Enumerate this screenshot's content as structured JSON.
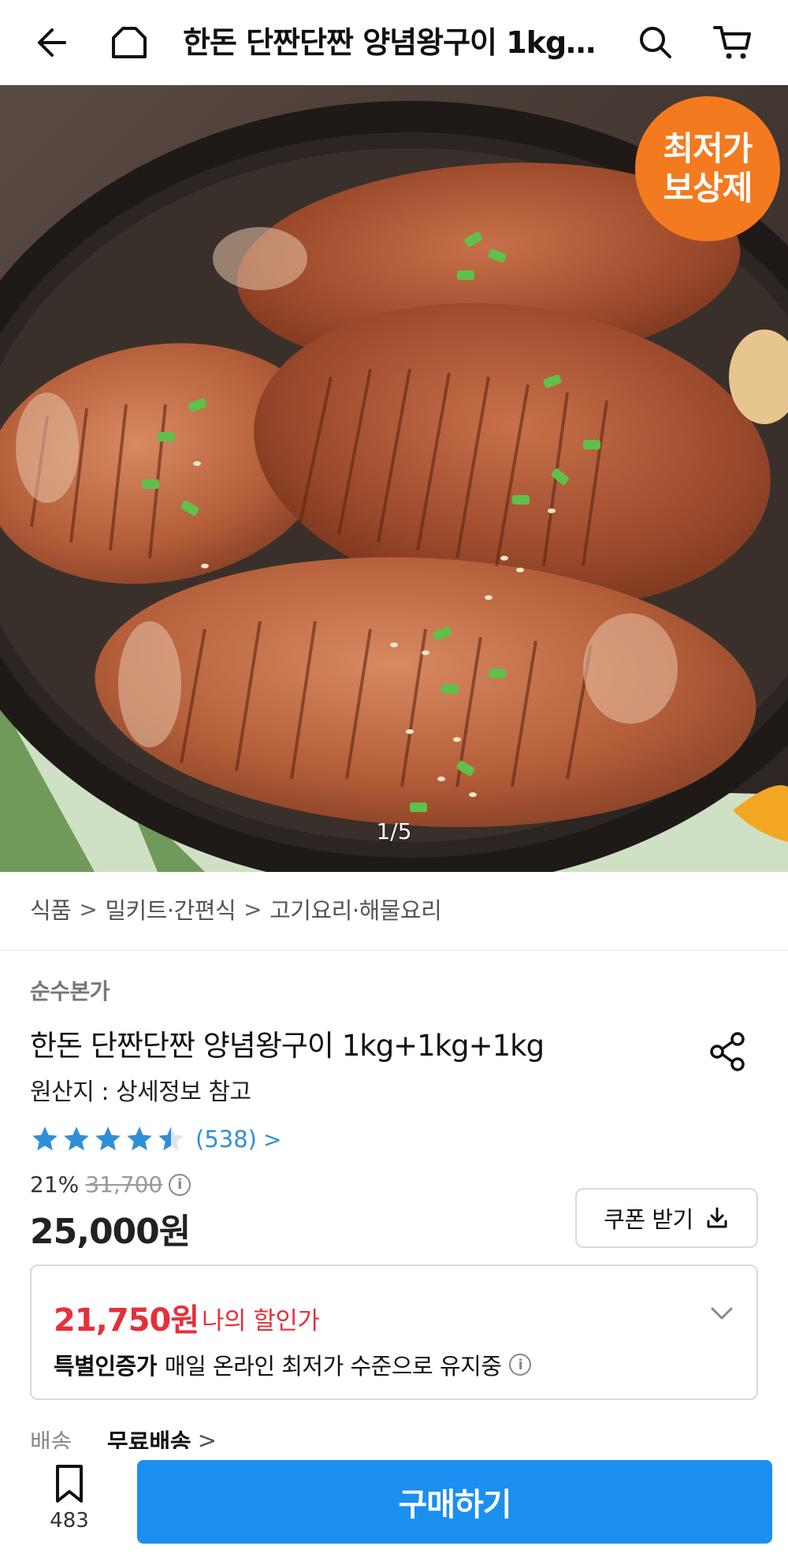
{
  "topbar": {
    "title": "한돈 단짠단짠 양념왕구이 1kg+1kg+1kg",
    "back_icon": "back-arrow-icon",
    "home_icon": "home-icon",
    "search_icon": "search-icon",
    "cart_icon": "cart-icon"
  },
  "hero": {
    "badge_line1": "최저가",
    "badge_line2": "보상제",
    "counter": "1/5"
  },
  "breadcrumb": {
    "items": [
      "식품",
      "밀키트·간편식",
      "고기요리·해물요리"
    ],
    "separator": ">"
  },
  "product": {
    "brand": "순수본가",
    "title": "한돈 단짠단짠 양념왕구이 1kg+1kg+1kg",
    "origin": "원산지 : 상세정보 참고",
    "rating": 4.5,
    "review_count": "(538)",
    "review_chevron": ">",
    "discount_rate": "21%",
    "original_price": "31,700",
    "price": "25,000원",
    "coupon_label": "쿠폰 받기"
  },
  "my_price": {
    "price": "21,750원",
    "label": "나의 할인가",
    "cert_bold": "특별인증가",
    "cert_text": "매일 온라인 최저가 수준으로 유지중"
  },
  "shipping": {
    "label": "배송",
    "value": "무료배송",
    "chevron": ">"
  },
  "bottom": {
    "bookmark_count": "483",
    "buy_label": "구매하기"
  },
  "colors": {
    "accent_blue": "#1a8ff0",
    "badge_orange": "#f47a1f",
    "discount_red": "#e5303a",
    "star_blue": "#2f8fd6"
  },
  "info_glyph": "i",
  "info_icon": "info-icon"
}
